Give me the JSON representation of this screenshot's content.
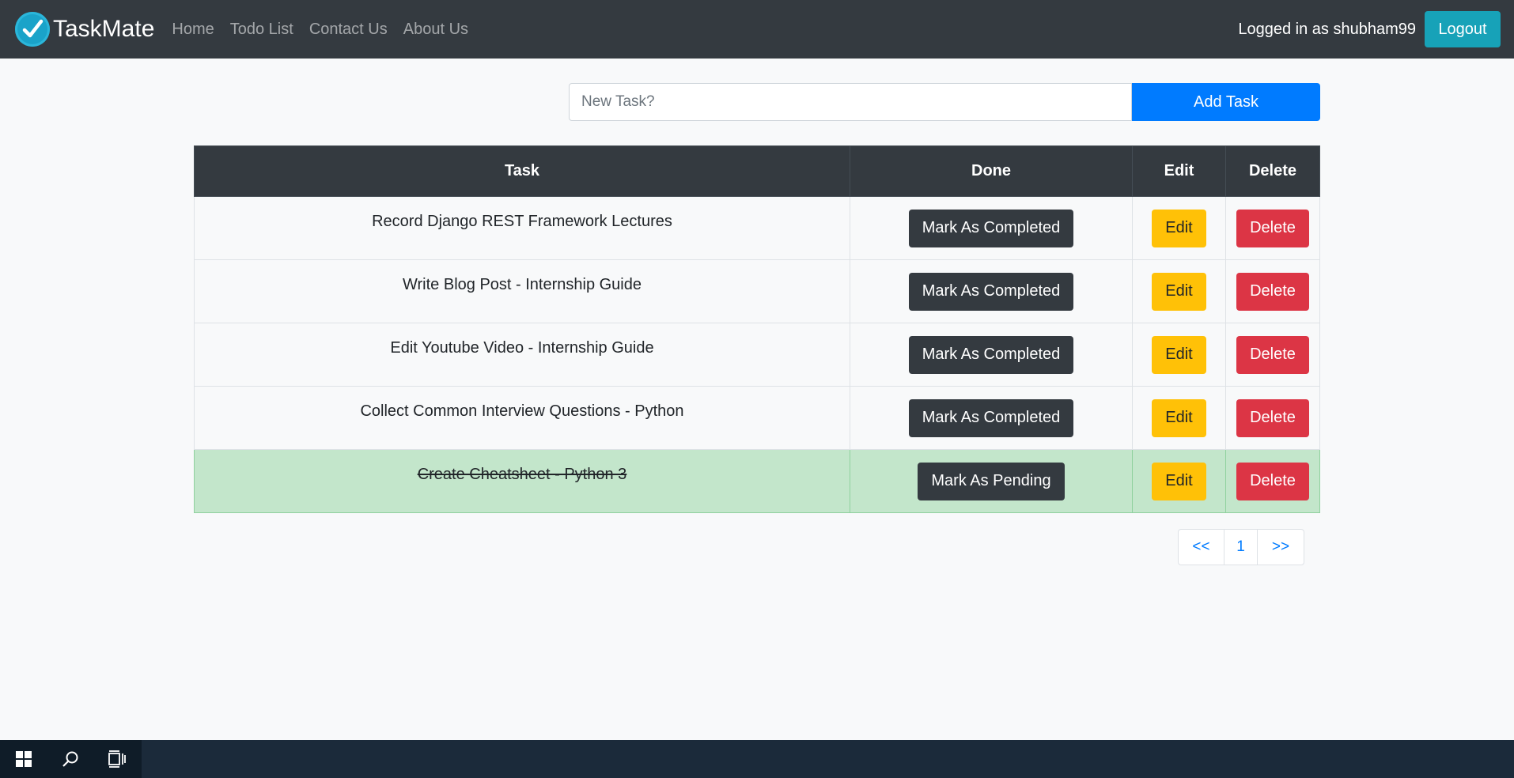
{
  "navbar": {
    "brand": "TaskMate",
    "links": [
      "Home",
      "Todo List",
      "Contact Us",
      "About Us"
    ],
    "logged_in_text": "Logged in as shubham99",
    "logout_label": "Logout"
  },
  "form": {
    "placeholder": "New Task?",
    "value": "",
    "add_label": "Add Task"
  },
  "table": {
    "headers": [
      "Task",
      "Done",
      "Edit",
      "Delete"
    ],
    "rows": [
      {
        "task": "Record Django REST Framework Lectures",
        "done_label": "Mark As Completed",
        "edit_label": "Edit",
        "delete_label": "Delete",
        "completed": false
      },
      {
        "task": "Write Blog Post - Internship Guide",
        "done_label": "Mark As Completed",
        "edit_label": "Edit",
        "delete_label": "Delete",
        "completed": false
      },
      {
        "task": "Edit Youtube Video - Internship Guide",
        "done_label": "Mark As Completed",
        "edit_label": "Edit",
        "delete_label": "Delete",
        "completed": false
      },
      {
        "task": "Collect Common Interview Questions - Python",
        "done_label": "Mark As Completed",
        "edit_label": "Edit",
        "delete_label": "Delete",
        "completed": false
      },
      {
        "task": "Create Cheatsheet - Python 3",
        "done_label": "Mark As Pending",
        "edit_label": "Edit",
        "delete_label": "Delete",
        "completed": true
      }
    ]
  },
  "pagination": {
    "prev": "<<",
    "page": "1",
    "next": ">>"
  },
  "taskbar": {
    "icons": [
      "windows-start-icon",
      "search-icon",
      "task-view-icon"
    ]
  },
  "colors": {
    "navbar": "#343a40",
    "primary": "#007bff",
    "info": "#17a2b8",
    "warning": "#ffc107",
    "danger": "#dc3545",
    "success_row": "#c3e6cb"
  }
}
